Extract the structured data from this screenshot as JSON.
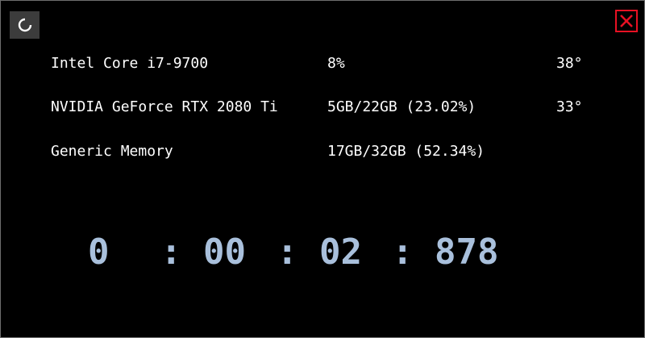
{
  "window": {
    "refresh_icon": "refresh-icon",
    "close_icon": "close-icon",
    "close_color": "#e81123",
    "timer_color": "#a9c0dc"
  },
  "stats": [
    {
      "name": "Intel Core i7-9700",
      "usage": "8%",
      "temperature": "38°"
    },
    {
      "name": "NVIDIA GeForce RTX 2080 Ti",
      "usage": "5GB/22GB (23.02%)",
      "temperature": "33°"
    },
    {
      "name": "Generic Memory",
      "usage": "17GB/32GB (52.34%)",
      "temperature": ""
    }
  ],
  "timer": {
    "days": "0",
    "sep1": ":",
    "hours": "00",
    "sep2": ":",
    "seconds": "02",
    "sep3": ":",
    "milliseconds": "878"
  }
}
